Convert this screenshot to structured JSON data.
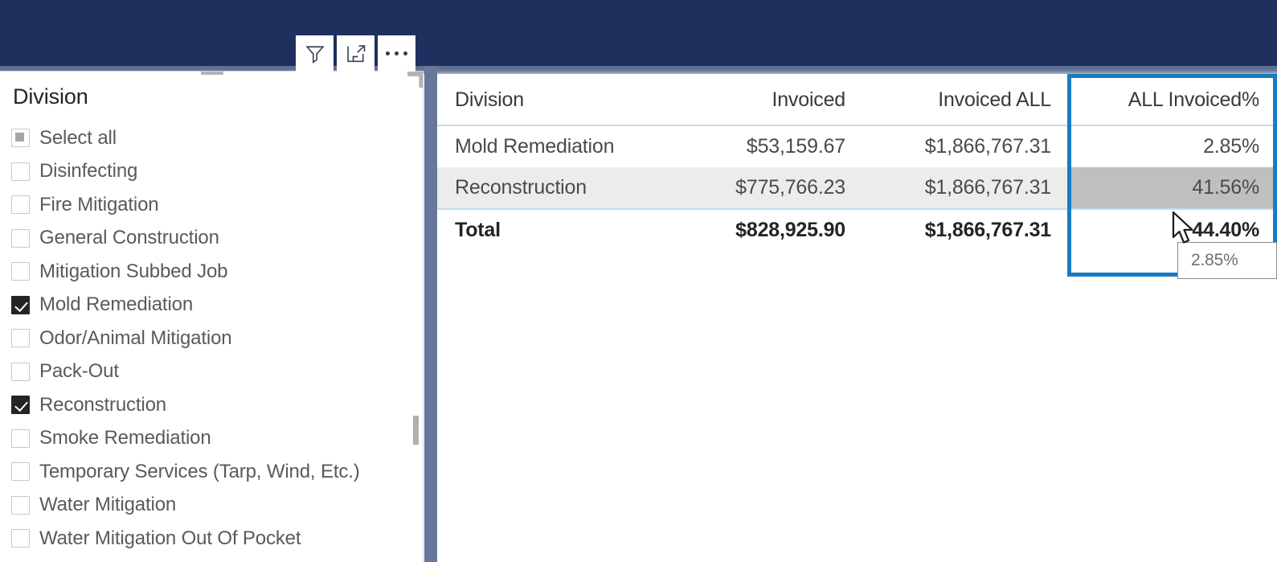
{
  "report": {
    "header_color": "#1f2f5e",
    "band_color": "#67769a",
    "accent_selection_color": "#1a7bc4"
  },
  "visual_header": {
    "buttons": [
      {
        "name": "filter-icon",
        "label": "Filters"
      },
      {
        "name": "focus-mode-icon",
        "label": "Focus mode"
      },
      {
        "name": "more-options-icon",
        "label": "More options"
      }
    ]
  },
  "slicer": {
    "title": "Division",
    "items": [
      {
        "label": "Select all",
        "state": "indeterminate"
      },
      {
        "label": "Disinfecting",
        "state": "unchecked"
      },
      {
        "label": "Fire Mitigation",
        "state": "unchecked"
      },
      {
        "label": "General Construction",
        "state": "unchecked"
      },
      {
        "label": "Mitigation Subbed Job",
        "state": "unchecked"
      },
      {
        "label": "Mold Remediation",
        "state": "checked"
      },
      {
        "label": "Odor/Animal Mitigation",
        "state": "unchecked"
      },
      {
        "label": "Pack-Out",
        "state": "unchecked"
      },
      {
        "label": "Reconstruction",
        "state": "checked"
      },
      {
        "label": "Smoke Remediation",
        "state": "unchecked"
      },
      {
        "label": "Temporary Services (Tarp, Wind, Etc.)",
        "state": "unchecked"
      },
      {
        "label": "Water Mitigation",
        "state": "unchecked"
      },
      {
        "label": "Water Mitigation Out Of Pocket",
        "state": "unchecked"
      }
    ]
  },
  "table": {
    "columns": [
      {
        "key": "division",
        "label": "Division",
        "align": "left"
      },
      {
        "key": "invoiced",
        "label": "Invoiced",
        "align": "right"
      },
      {
        "key": "invoiced_all",
        "label": "Invoiced ALL",
        "align": "right"
      },
      {
        "key": "all_pct",
        "label": "ALL Invoiced%",
        "align": "right"
      }
    ],
    "rows": [
      {
        "division": "Mold Remediation",
        "invoiced": "$53,159.67",
        "invoiced_all": "$1,866,767.31",
        "all_pct": "2.85%",
        "highlighted": false,
        "hovered_cell": false
      },
      {
        "division": "Reconstruction",
        "invoiced": "$775,766.23",
        "invoiced_all": "$1,866,767.31",
        "all_pct": "41.56%",
        "highlighted": true,
        "hovered_cell": true
      }
    ],
    "total_row": {
      "division": "Total",
      "invoiced": "$828,925.90",
      "invoiced_all": "$1,866,767.31",
      "all_pct": "44.40%"
    },
    "selected_column": "ALL Invoiced%"
  },
  "tooltip": {
    "value": "2.85%"
  }
}
